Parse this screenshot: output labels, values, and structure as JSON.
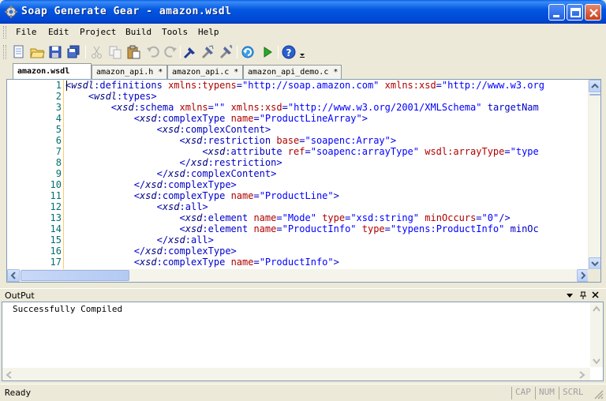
{
  "window": {
    "title": "Soap Generate Gear - amazon.wsdl",
    "icon": "app-gear-icon"
  },
  "menu": [
    "File",
    "Edit",
    "Project",
    "Build",
    "Tools",
    "Help"
  ],
  "toolbar": {
    "icons": [
      "new-file-icon",
      "open-folder-icon",
      "save-icon",
      "save-all-icon",
      "cut-icon",
      "copy-icon",
      "paste-icon",
      "undo-icon",
      "redo-icon",
      "compile-icon",
      "build-icon",
      "rebuild-icon",
      "refresh-icon",
      "run-icon",
      "help-icon"
    ]
  },
  "tabs": [
    {
      "label": "amazon.wsdl",
      "active": true
    },
    {
      "label": "amazon_api.h *",
      "active": false
    },
    {
      "label": "amazon_api.c *",
      "active": false
    },
    {
      "label": "amazon_api_demo.c *",
      "active": false
    }
  ],
  "editor": {
    "line_numbers": [
      "1",
      "2",
      "3",
      "4",
      "5",
      "6",
      "7",
      "8",
      "9",
      "10",
      "11",
      "12",
      "13",
      "14",
      "15",
      "16",
      "17"
    ],
    "lines": [
      "<wsdl:definitions xmlns:typens=\"http://soap.amazon.com\" xmlns:xsd=\"http://www.w3.org",
      "    <wsdl:types>",
      "        <xsd:schema xmlns=\"\" xmlns:xsd=\"http://www.w3.org/2001/XMLSchema\" targetNam",
      "            <xsd:complexType name=\"ProductLineArray\">",
      "                <xsd:complexContent>",
      "                    <xsd:restriction base=\"soapenc:Array\">",
      "                        <xsd:attribute ref=\"soapenc:arrayType\" wsdl:arrayType=\"type",
      "                    </xsd:restriction>",
      "                </xsd:complexContent>",
      "            </xsd:complexType>",
      "            <xsd:complexType name=\"ProductLine\">",
      "                <xsd:all>",
      "                    <xsd:element name=\"Mode\" type=\"xsd:string\" minOccurs=\"0\"/>",
      "                    <xsd:element name=\"ProductInfo\" type=\"typens:ProductInfo\" minOc",
      "                </xsd:all>",
      "            </xsd:complexType>",
      "            <xsd:complexType name=\"ProductInfo\">"
    ]
  },
  "output": {
    "title": "OutPut",
    "message": "Successfully Compiled"
  },
  "status": {
    "text": "Ready",
    "indicators": [
      "CAP",
      "NUM",
      "SCRL"
    ]
  }
}
